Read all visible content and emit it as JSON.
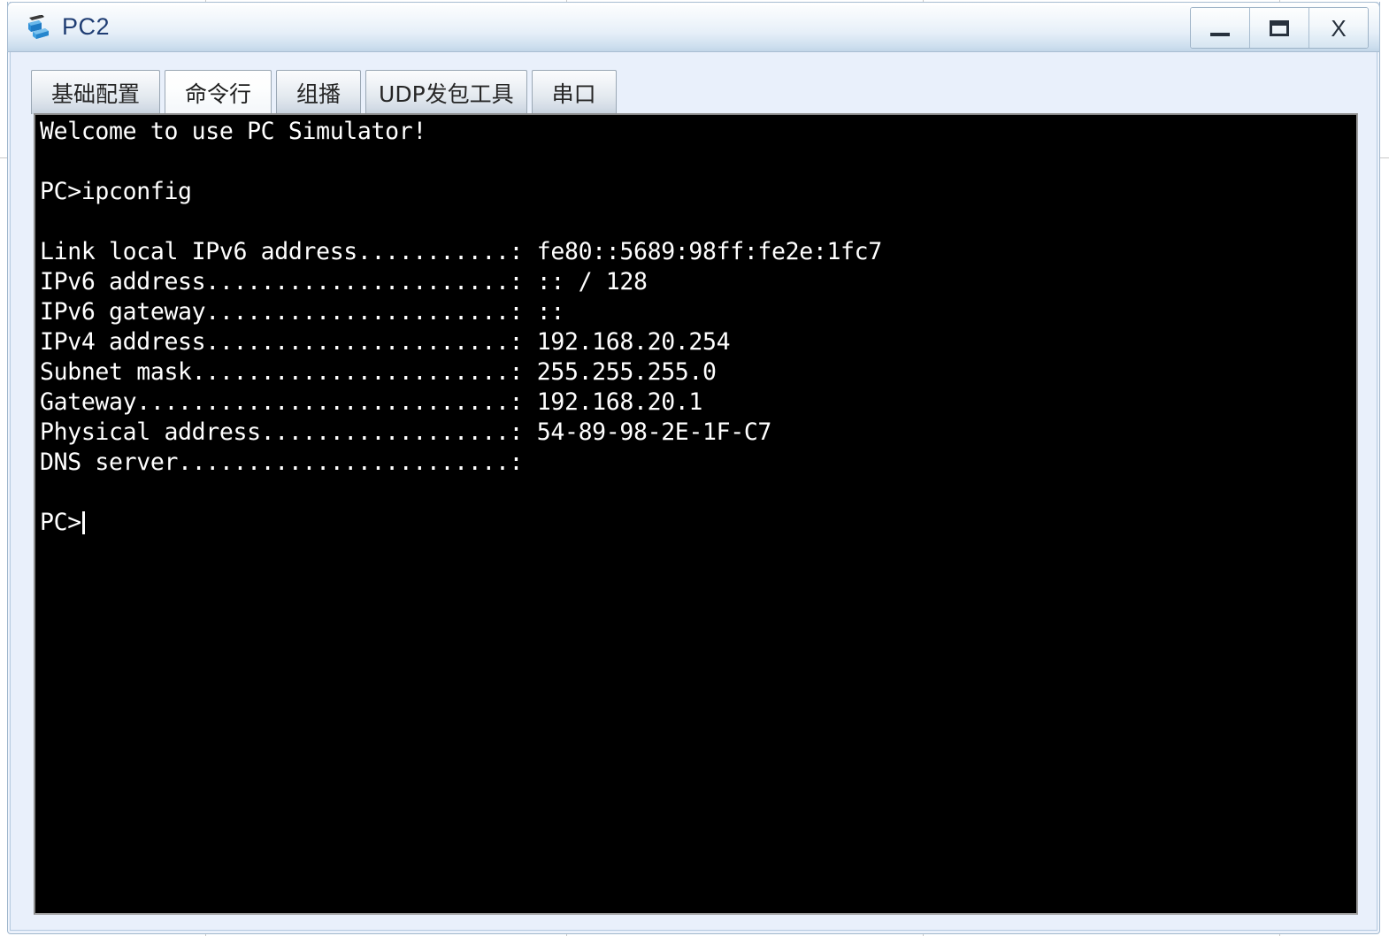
{
  "window": {
    "title": "PC2",
    "icon": "pc-device-icon",
    "controls": [
      {
        "name": "minimize-button",
        "glyph": "–",
        "label": "_"
      },
      {
        "name": "maximize-button",
        "glyph": "▭",
        "label": "▭"
      },
      {
        "name": "close-button",
        "glyph": "X",
        "label": "X"
      }
    ]
  },
  "tabs": [
    {
      "label": "基础配置",
      "name": "tab-basic-config",
      "selected": false
    },
    {
      "label": "命令行",
      "name": "tab-command-line",
      "selected": true
    },
    {
      "label": "组播",
      "name": "tab-multicast",
      "selected": false
    },
    {
      "label": "UDP发包工具",
      "name": "tab-udp-tool",
      "selected": false
    },
    {
      "label": "串口",
      "name": "tab-serial-port",
      "selected": false
    }
  ],
  "terminal": {
    "welcome": "Welcome to use PC Simulator!",
    "command_line": "PC>ipconfig",
    "prompt": "PC>",
    "fields": [
      {
        "label": "Link local IPv6 address",
        "dots": "...........",
        "value": "fe80::5689:98ff:fe2e:1fc7"
      },
      {
        "label": "IPv6 address",
        "dots": "......................",
        "value": ":: / 128"
      },
      {
        "label": "IPv6 gateway",
        "dots": "......................",
        "value": "::"
      },
      {
        "label": "IPv4 address",
        "dots": "......................",
        "value": "192.168.20.254"
      },
      {
        "label": "Subnet mask",
        "dots": ".......................",
        "value": "255.255.255.0"
      },
      {
        "label": "Gateway",
        "dots": "...........................",
        "value": "192.168.20.1"
      },
      {
        "label": "Physical address",
        "dots": "..................",
        "value": "54-89-98-2E-1F-C7"
      },
      {
        "label": "DNS server",
        "dots": "........................",
        "value": ""
      }
    ],
    "text": "Welcome to use PC Simulator!\n\nPC>ipconfig\n\nLink local IPv6 address...........: fe80::5689:98ff:fe2e:1fc7\nIPv6 address......................: :: / 128\nIPv6 gateway......................: ::\nIPv4 address......................: 192.168.20.254\nSubnet mask.......................: 255.255.255.0\nGateway...........................: 192.168.20.1\nPhysical address..................: 54-89-98-2E-1F-C7\nDNS server........................:\n\nPC>"
  },
  "colors": {
    "terminal_bg": "#000000",
    "terminal_fg": "#ffffff",
    "window_bg": "#e9f0fb",
    "title_accent": "#1f3d73",
    "border": "#9fb6cd"
  }
}
